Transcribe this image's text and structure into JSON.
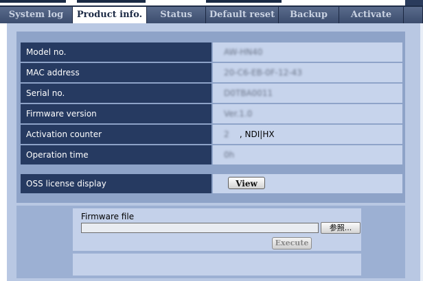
{
  "tabs": [
    {
      "label": "System log"
    },
    {
      "label": "Product info."
    },
    {
      "label": "Status"
    },
    {
      "label": "Default reset"
    },
    {
      "label": "Backup"
    },
    {
      "label": "Activate"
    }
  ],
  "active_tab": "Product info.",
  "info_rows": [
    {
      "label": "Model no.",
      "value": "AW-HN40"
    },
    {
      "label": "MAC address",
      "value": "20-C6-EB-0F-12-43"
    },
    {
      "label": "Serial no.",
      "value": "D0TBA0011"
    },
    {
      "label": "Firmware version",
      "value": "Ver.1.0"
    },
    {
      "label": "Activation counter",
      "value_prefix": "2",
      "value_suffix": ", NDI|HX"
    },
    {
      "label": "Operation time",
      "value": "0h"
    }
  ],
  "oss": {
    "label": "OSS license display",
    "button": "View"
  },
  "firmware": {
    "label": "Firmware file",
    "browse_button": "参照...",
    "execute_button": "Execute"
  },
  "colors": {
    "tab_bar": "#1e2c47",
    "label_cell": "#263a61",
    "value_cell": "#c7d4ec",
    "panel": "#b9c8e3"
  }
}
